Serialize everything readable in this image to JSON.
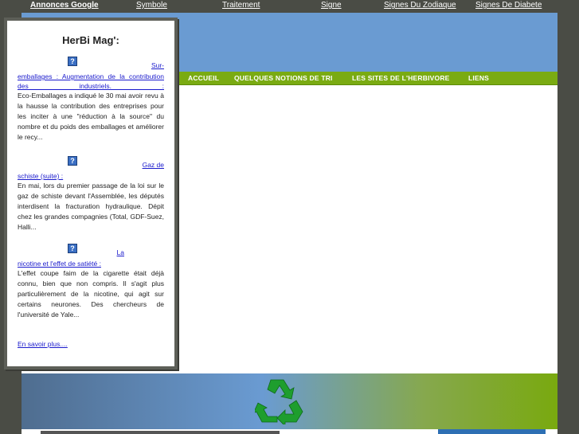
{
  "adbar": {
    "brand": "Annonces Google",
    "links": [
      "Symbole",
      "Traitement",
      "Signe",
      "Signes Du Zodiaque",
      "Signes De Diabete"
    ]
  },
  "nav": {
    "items": [
      "ACCUEIL",
      "QUELQUES NOTIONS DE TRI",
      "LES SITES DE L'HERBIVORE",
      "LIENS"
    ]
  },
  "sidebar": {
    "title": "HerBi Mag':",
    "icon_glyph": "?",
    "articles": [
      {
        "link_first": "Sur-",
        "link_rest": "emballages : Augmentation de la contribution des industriels. :",
        "text": "Eco-Emballages a indiqué le 30 mai avoir revu à la hausse la contribution des entreprises pour les inciter à une \"réduction à la source\" du nombre et du poids des emballages et améliorer le recy..."
      },
      {
        "link_first": "Gaz de",
        "link_rest": "schiste (suite) :",
        "text": "En mai, lors du premier passage de la loi sur le gaz de schiste devant l'Assemblée, les députés interdisent la fracturation hydraulique. Dépit chez les grandes compagnies (Total, GDF-Suez, Halli..."
      },
      {
        "link_first": "La",
        "link_rest": "nicotine et l'effet de satiété :",
        "text": "L'effet coupe faim de la cigarette était déjà connu, bien que non compris. Il s'agit plus particulièrement de la nicotine, qui agit sur certains neurones. Des chercheurs de l'université de Yale..."
      }
    ],
    "more_label": "En savoir plus...."
  },
  "colors": {
    "banner_blue": "#6a9bd2",
    "nav_green": "#7aab12",
    "recycle_green": "#1e9e2e",
    "background_dark": "#4a4c45"
  }
}
